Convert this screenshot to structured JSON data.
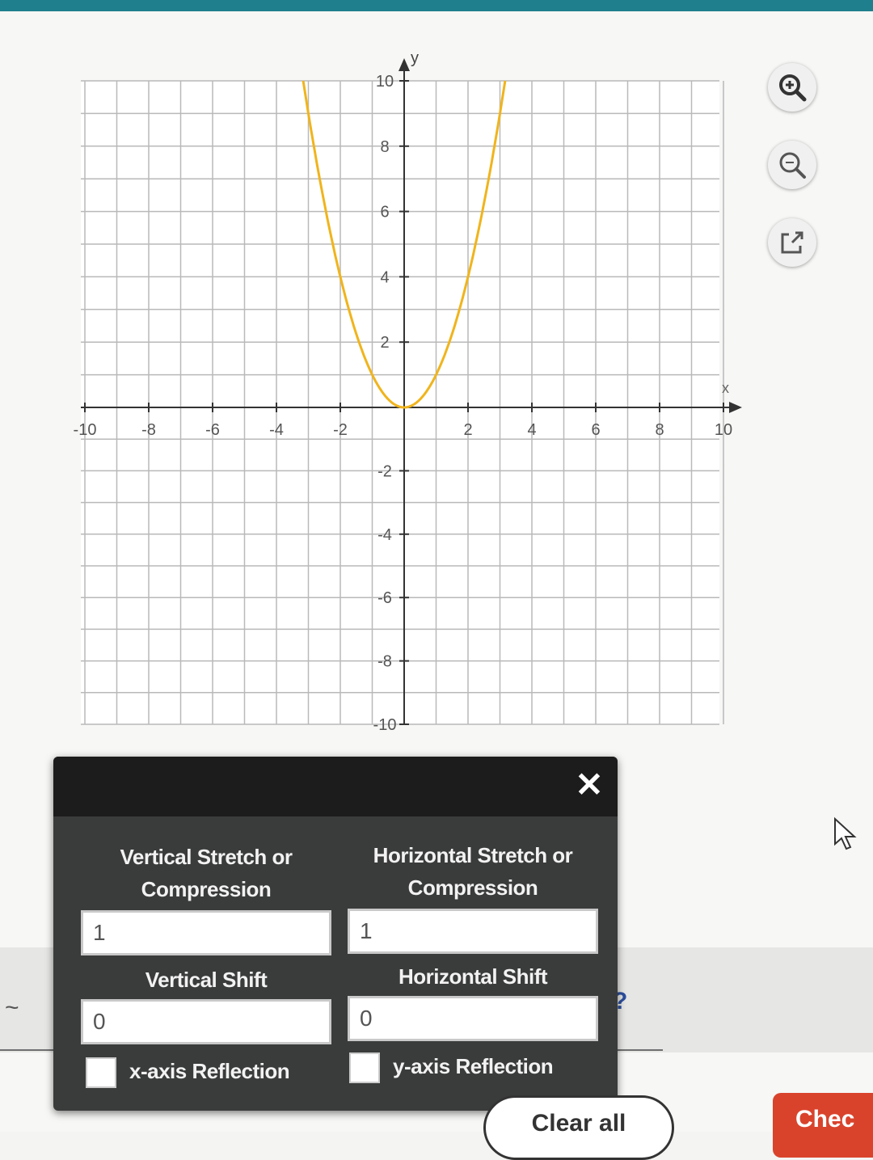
{
  "colors": {
    "topbar": "#1f7f8c",
    "curve": "#f0b41c",
    "panel_bg": "#3a3b3b",
    "panel_header": "#1c1c1c",
    "check_button": "#d9432c",
    "help_icon": "#2c4f9e"
  },
  "graph": {
    "xlabel": "x",
    "ylabel": "y",
    "xlim": [
      -10,
      10
    ],
    "ylim": [
      -10,
      10
    ],
    "grid_step": 1,
    "x_ticks": [
      {
        "value": -10,
        "label": "-10"
      },
      {
        "value": -8,
        "label": "-8"
      },
      {
        "value": -6,
        "label": "-6"
      },
      {
        "value": -4,
        "label": "-4"
      },
      {
        "value": -2,
        "label": "-2"
      },
      {
        "value": 2,
        "label": "2"
      },
      {
        "value": 4,
        "label": "4"
      },
      {
        "value": 6,
        "label": "6"
      },
      {
        "value": 8,
        "label": "8"
      },
      {
        "value": 10,
        "label": "10"
      }
    ],
    "y_ticks": [
      {
        "value": 10,
        "label": "10"
      },
      {
        "value": 8,
        "label": "8"
      },
      {
        "value": 6,
        "label": "6"
      },
      {
        "value": 4,
        "label": "4"
      },
      {
        "value": 2,
        "label": "2"
      },
      {
        "value": -2,
        "label": "-2"
      },
      {
        "value": -4,
        "label": "-4"
      },
      {
        "value": -6,
        "label": "-6"
      },
      {
        "value": -8,
        "label": "-8"
      },
      {
        "value": -10,
        "label": "-10"
      }
    ],
    "curve": {
      "type": "parabola",
      "vertex": [
        0,
        0
      ],
      "a": 1
    }
  },
  "tools": {
    "zoom_in_icon": "zoom-in-icon",
    "zoom_out_icon": "zoom-out-icon",
    "popout_icon": "popout-icon"
  },
  "panel": {
    "close_label": "✕",
    "vertical_stretch_label_1": "Vertical Stretch or",
    "vertical_stretch_label_2": "Compression",
    "horizontal_stretch_label_1": "Horizontal Stretch or",
    "horizontal_stretch_label_2": "Compression",
    "vertical_stretch_value": "1",
    "horizontal_stretch_value": "1",
    "vertical_shift_label": "Vertical Shift",
    "horizontal_shift_label": "Horizontal Shift",
    "vertical_shift_value": "0",
    "horizontal_shift_value": "0",
    "x_reflection_label": "x-axis Reflection",
    "y_reflection_label": "y-axis Reflection"
  },
  "help_label": "?",
  "clear_all_label": "Clear all",
  "check_label": "Chec"
}
